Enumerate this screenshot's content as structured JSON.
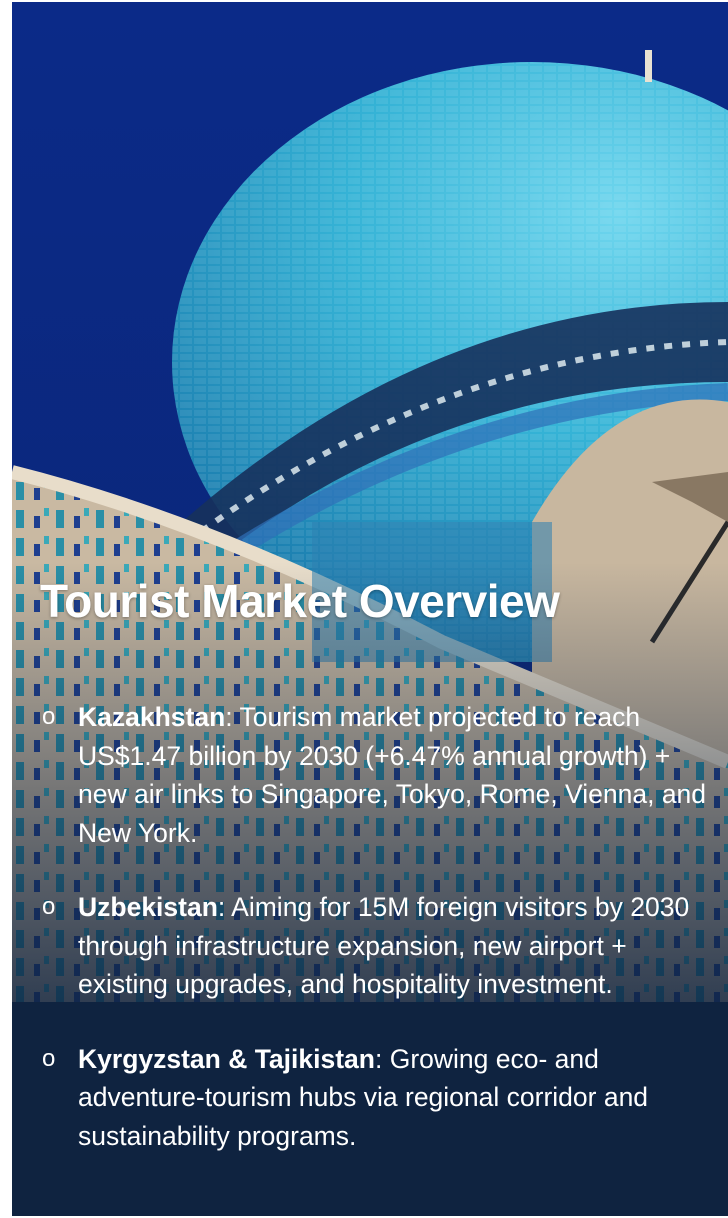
{
  "slide": {
    "title": "Tourist Market Overview",
    "bullets": [
      {
        "marker": "o",
        "heading": "Kazakhstan",
        "text": ": Tourism market projected to reach US$1.47 billion by 2030 (+6.47% annual growth) +  new air links to Singapore, Tokyo, Rome, Vienna, and New York."
      },
      {
        "marker": "o",
        "heading": "Uzbekistan",
        "text": ": Aiming for 15M foreign visitors by 2030 through infrastructure expansion, new airport + existing upgrades, and hospitality investment."
      },
      {
        "marker": "o",
        "heading": "Kyrgyzstan & Tajikistan",
        "text": ": Growing eco- and adventure-tourism hubs via regional corridor and sustainability programs."
      }
    ]
  },
  "colors": {
    "sky": "#0c2c86",
    "overlay": "#0f2340",
    "dome": "#3bb8d8",
    "text": "#ffffff"
  }
}
